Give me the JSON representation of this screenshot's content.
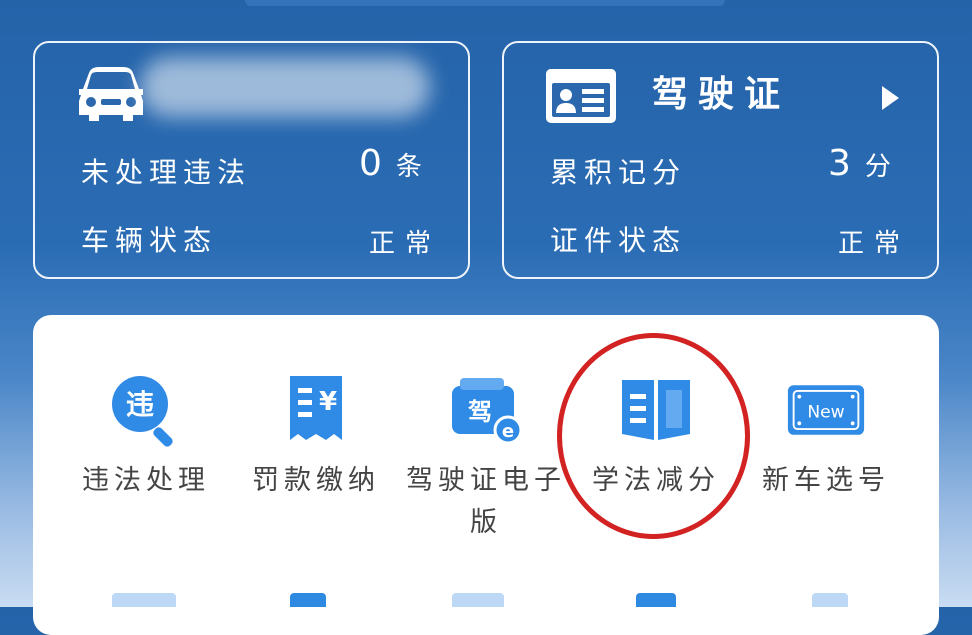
{
  "vehicle_card": {
    "icon": "car-icon",
    "plate": "",
    "violations_label": "未处理违法",
    "violations_count": "0",
    "violations_unit": "条",
    "status_label": "车辆状态",
    "status_value": "正常"
  },
  "license_card": {
    "icon": "id-card-icon",
    "title": "驾驶证",
    "points_label": "累积记分",
    "points_value": "3",
    "points_unit": "分",
    "status_label": "证件状态",
    "status_value": "正常"
  },
  "services": [
    {
      "label": "违法处理",
      "icon": "violation-search-icon"
    },
    {
      "label": "罚款缴纳",
      "icon": "fine-payment-icon"
    },
    {
      "label": "驾驶证电子版",
      "icon": "e-license-icon"
    },
    {
      "label": "学法减分",
      "icon": "book-icon"
    },
    {
      "label": "新车选号",
      "icon": "new-plate-icon"
    }
  ],
  "service_icon_texts": {
    "violation": "违",
    "fine": "¥",
    "license": "驾",
    "new": "New"
  },
  "colors": {
    "accent_blue": "#2f8be6",
    "highlight_red": "#d22222",
    "header_blue": "#2563a9"
  }
}
